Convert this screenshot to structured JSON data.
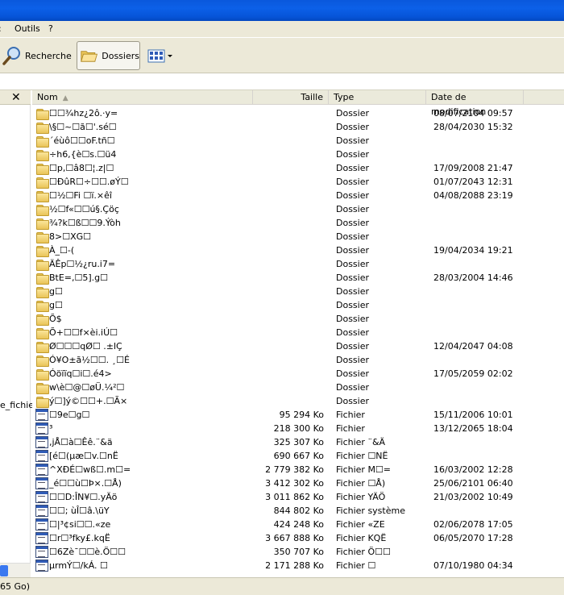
{
  "menubar": {
    "items": [
      ":",
      "Outils",
      "?"
    ]
  },
  "toolbar": {
    "search_label": "Recherche",
    "folders_label": "Dossiers",
    "views_icon": "views-icon"
  },
  "leftpane": {
    "close_glyph": "✕",
    "fragment_text": "e_fichier"
  },
  "columns": {
    "name": "Nom",
    "size": "Taille",
    "type": "Type",
    "date": "Date de modification"
  },
  "rows": [
    {
      "icon": "folder-icon",
      "name": "☐☐¾hz¿2ô.·y=",
      "size": "",
      "type": "Dossier",
      "date": "08/07/2104 09:57"
    },
    {
      "icon": "folder-icon",
      "name": "\\§☐~☐ã☐'.sé☐",
      "size": "",
      "type": "Dossier",
      "date": "28/04/2030 15:32"
    },
    {
      "icon": "folder-icon",
      "name": "´éùô☐☐oF.tñ☐",
      "size": "",
      "type": "Dossier",
      "date": ""
    },
    {
      "icon": "folder-icon",
      "name": "÷h6,{è☐s.☐ü4",
      "size": "",
      "type": "Dossier",
      "date": ""
    },
    {
      "icon": "folder-icon",
      "name": "☐p,☐â8☐¦.z|☐",
      "size": "",
      "type": "Dossier",
      "date": "17/09/2008 21:47"
    },
    {
      "icon": "folder-icon",
      "name": "☐ÐûR☐÷☐☐.øÝ☐",
      "size": "",
      "type": "Dossier",
      "date": "01/07/2043 12:31"
    },
    {
      "icon": "folder-icon",
      "name": "☐½☐Fi ☐ï.×êî",
      "size": "",
      "type": "Dossier",
      "date": "04/08/2088 23:19"
    },
    {
      "icon": "folder-icon",
      "name": "½☐f«☐☐ú§.Çöç",
      "size": "",
      "type": "Dossier",
      "date": ""
    },
    {
      "icon": "folder-icon",
      "name": "¾?k☐ß☐☐9.Ýòh",
      "size": "",
      "type": "Dossier",
      "date": ""
    },
    {
      "icon": "folder-icon",
      "name": "8>☐XG☐",
      "size": "",
      "type": "Dossier",
      "date": ""
    },
    {
      "icon": "folder-icon",
      "name": "À_☐-(",
      "size": "",
      "type": "Dossier",
      "date": "19/04/2034 19:21"
    },
    {
      "icon": "folder-icon",
      "name": "ÄÊp☐½¿ru.i7=",
      "size": "",
      "type": "Dossier",
      "date": ""
    },
    {
      "icon": "folder-icon",
      "name": "BtE=,☐5].g☐",
      "size": "",
      "type": "Dossier",
      "date": "28/03/2004 14:46"
    },
    {
      "icon": "folder-icon",
      "name": "g☐",
      "size": "",
      "type": "Dossier",
      "date": ""
    },
    {
      "icon": "folder-icon",
      "name": "g☐",
      "size": "",
      "type": "Dossier",
      "date": ""
    },
    {
      "icon": "folder-icon",
      "name": "Õ$",
      "size": "",
      "type": "Dossier",
      "date": ""
    },
    {
      "icon": "folder-icon",
      "name": "Õ+☐☐f×èi.iÚ☐",
      "size": "",
      "type": "Dossier",
      "date": ""
    },
    {
      "icon": "folder-icon",
      "name": "Ø☐☐☐qØ☐ .±lÇ",
      "size": "",
      "type": "Dossier",
      "date": "12/04/2047 04:08"
    },
    {
      "icon": "folder-icon",
      "name": "Ó¥O±ã½☐☐. ¸☐É",
      "size": "",
      "type": "Dossier",
      "date": ""
    },
    {
      "icon": "folder-icon",
      "name": "Óöïïq☐i☐.é4>",
      "size": "",
      "type": "Dossier",
      "date": "17/05/2059 02:02"
    },
    {
      "icon": "folder-icon",
      "name": "w\\è☐@☐øÜ.¼²☐",
      "size": "",
      "type": "Dossier",
      "date": ""
    },
    {
      "icon": "folder-icon",
      "name": "ý☐]ý©☐☐+.☐Ã×",
      "size": "",
      "type": "Dossier",
      "date": ""
    },
    {
      "icon": "file-icon",
      "name": "☐9e☐g☐",
      "size": "95 294 Ko",
      "type": "Fichier",
      "date": "15/11/2006 10:01"
    },
    {
      "icon": "file-icon",
      "name": "³",
      "size": "218 300 Ko",
      "type": "Fichier",
      "date": "13/12/2065 18:04"
    },
    {
      "icon": "file-icon",
      "name": ",jÅ☐à☐Êê.¨&ä",
      "size": "325 307 Ko",
      "type": "Fichier ¨&Ä",
      "date": ""
    },
    {
      "icon": "file-icon",
      "name": "[é☐(µæ☐v.☐nË",
      "size": "690 667 Ko",
      "type": "Fichier ☐NË",
      "date": ""
    },
    {
      "icon": "file-icon",
      "name": "^XÐÉ☐wß☐.m☐=",
      "size": "2 779 382 Ko",
      "type": "Fichier M☐=",
      "date": "16/03/2002 12:28"
    },
    {
      "icon": "file-icon",
      "name": "_é☐☐ù☐Þ×.☐Å)",
      "size": "3 412 302 Ko",
      "type": "Fichier ☐Å)",
      "date": "25/06/2101 06:40"
    },
    {
      "icon": "file-icon",
      "name": "☐☐D:ÎN¥☐.yÄö",
      "size": "3 011 862 Ko",
      "type": "Fichier YÄÖ",
      "date": "21/03/2002 10:49"
    },
    {
      "icon": "file-icon",
      "name": "☐☐; ùÎ☐â.\\üY",
      "size": "844 802 Ko",
      "type": "Fichier système",
      "date": ""
    },
    {
      "icon": "file-icon",
      "name": "☐|³¢si☐☐.«ze",
      "size": "424 248 Ko",
      "type": "Fichier «ZE",
      "date": "02/06/2078 17:05"
    },
    {
      "icon": "file-icon",
      "name": "☐r☐³fky£.kqË",
      "size": "3 667 888 Ko",
      "type": "Fichier KQË",
      "date": "06/05/2070 17:28"
    },
    {
      "icon": "file-icon",
      "name": "☐6Zè¯☐☐è.Ö☐☐",
      "size": "350 707 Ko",
      "type": "Fichier Ö☐☐",
      "date": ""
    },
    {
      "icon": "file-icon",
      "name": "µrmÝ☐/kÁ.  ☐",
      "size": "2 171 288 Ko",
      "type": "Fichier   ☐",
      "date": "07/10/1980 04:34"
    }
  ],
  "statusbar": {
    "text": "65 Go)"
  }
}
